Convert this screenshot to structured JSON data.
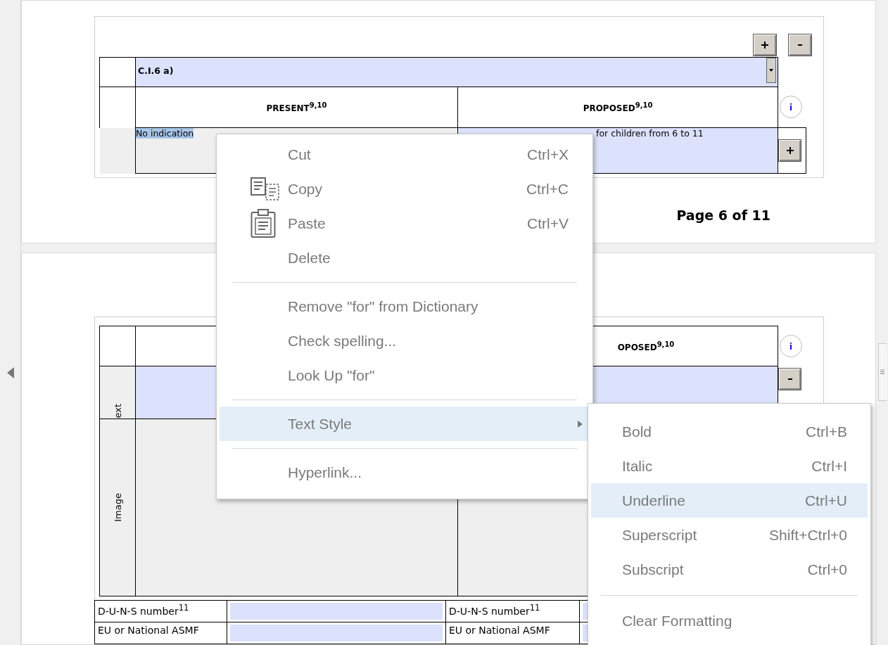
{
  "page1": {
    "section": {
      "value": "C.I.6 a)"
    },
    "headers": [
      "PRESENT$^{9,10}$",
      "PROPOSED$^{9,10}$"
    ],
    "row": {
      "present": "No indication",
      "proposed": "for children from 6 to 11"
    },
    "footer": "Page 6 of 11",
    "info": "i"
  },
  "page2": {
    "header": "OPOSED$^{9,10}$",
    "info": "i",
    "row_labels": [
      "ext",
      "Image"
    ],
    "fields": [
      {
        "label": "D-U-N-S number$^{11}$",
        "label_2": "D-U-N-S number$^{11}$"
      },
      {
        "label": "EU or National ASMF",
        "label_2": "EU or National ASMF"
      }
    ]
  },
  "context_menu": {
    "items": [
      {
        "kind": "plain",
        "label": "Cut",
        "shortcut": "Ctrl+X",
        "selected": false
      },
      {
        "kind": "copy",
        "label": "Copy",
        "shortcut": "Ctrl+C",
        "selected": false
      },
      {
        "kind": "paste",
        "label": "Paste",
        "shortcut": "Ctrl+V",
        "selected": false
      },
      {
        "kind": "plain",
        "label": "Delete",
        "selected": false
      },
      {
        "kind": "separator"
      },
      {
        "kind": "plain",
        "label": "Remove \"for\" from Dictionary",
        "selected": false
      },
      {
        "kind": "plain",
        "label": "Check spelling...",
        "selected": false
      },
      {
        "kind": "plain",
        "label": "Look Up \"for\"",
        "selected": false
      },
      {
        "kind": "separator"
      },
      {
        "kind": "submenu",
        "label": "Text Style",
        "selected": true
      },
      {
        "kind": "separator"
      },
      {
        "kind": "plain",
        "label": "Hyperlink...",
        "selected": false
      }
    ]
  },
  "submenu": {
    "items": [
      {
        "kind": "plain",
        "label": "Bold",
        "shortcut": "Ctrl+B",
        "selected": false
      },
      {
        "kind": "plain",
        "label": "Italic",
        "shortcut": "Ctrl+I",
        "selected": false
      },
      {
        "kind": "plain",
        "label": "Underline",
        "shortcut": "Ctrl+U",
        "selected": true
      },
      {
        "kind": "plain",
        "label": "Superscript",
        "shortcut": "Shift+Ctrl+0",
        "selected": false
      },
      {
        "kind": "plain",
        "label": "Subscript",
        "shortcut": "Ctrl+0",
        "selected": false
      },
      {
        "kind": "separator"
      },
      {
        "kind": "plain",
        "label": "Clear Formatting",
        "selected": false
      }
    ]
  }
}
